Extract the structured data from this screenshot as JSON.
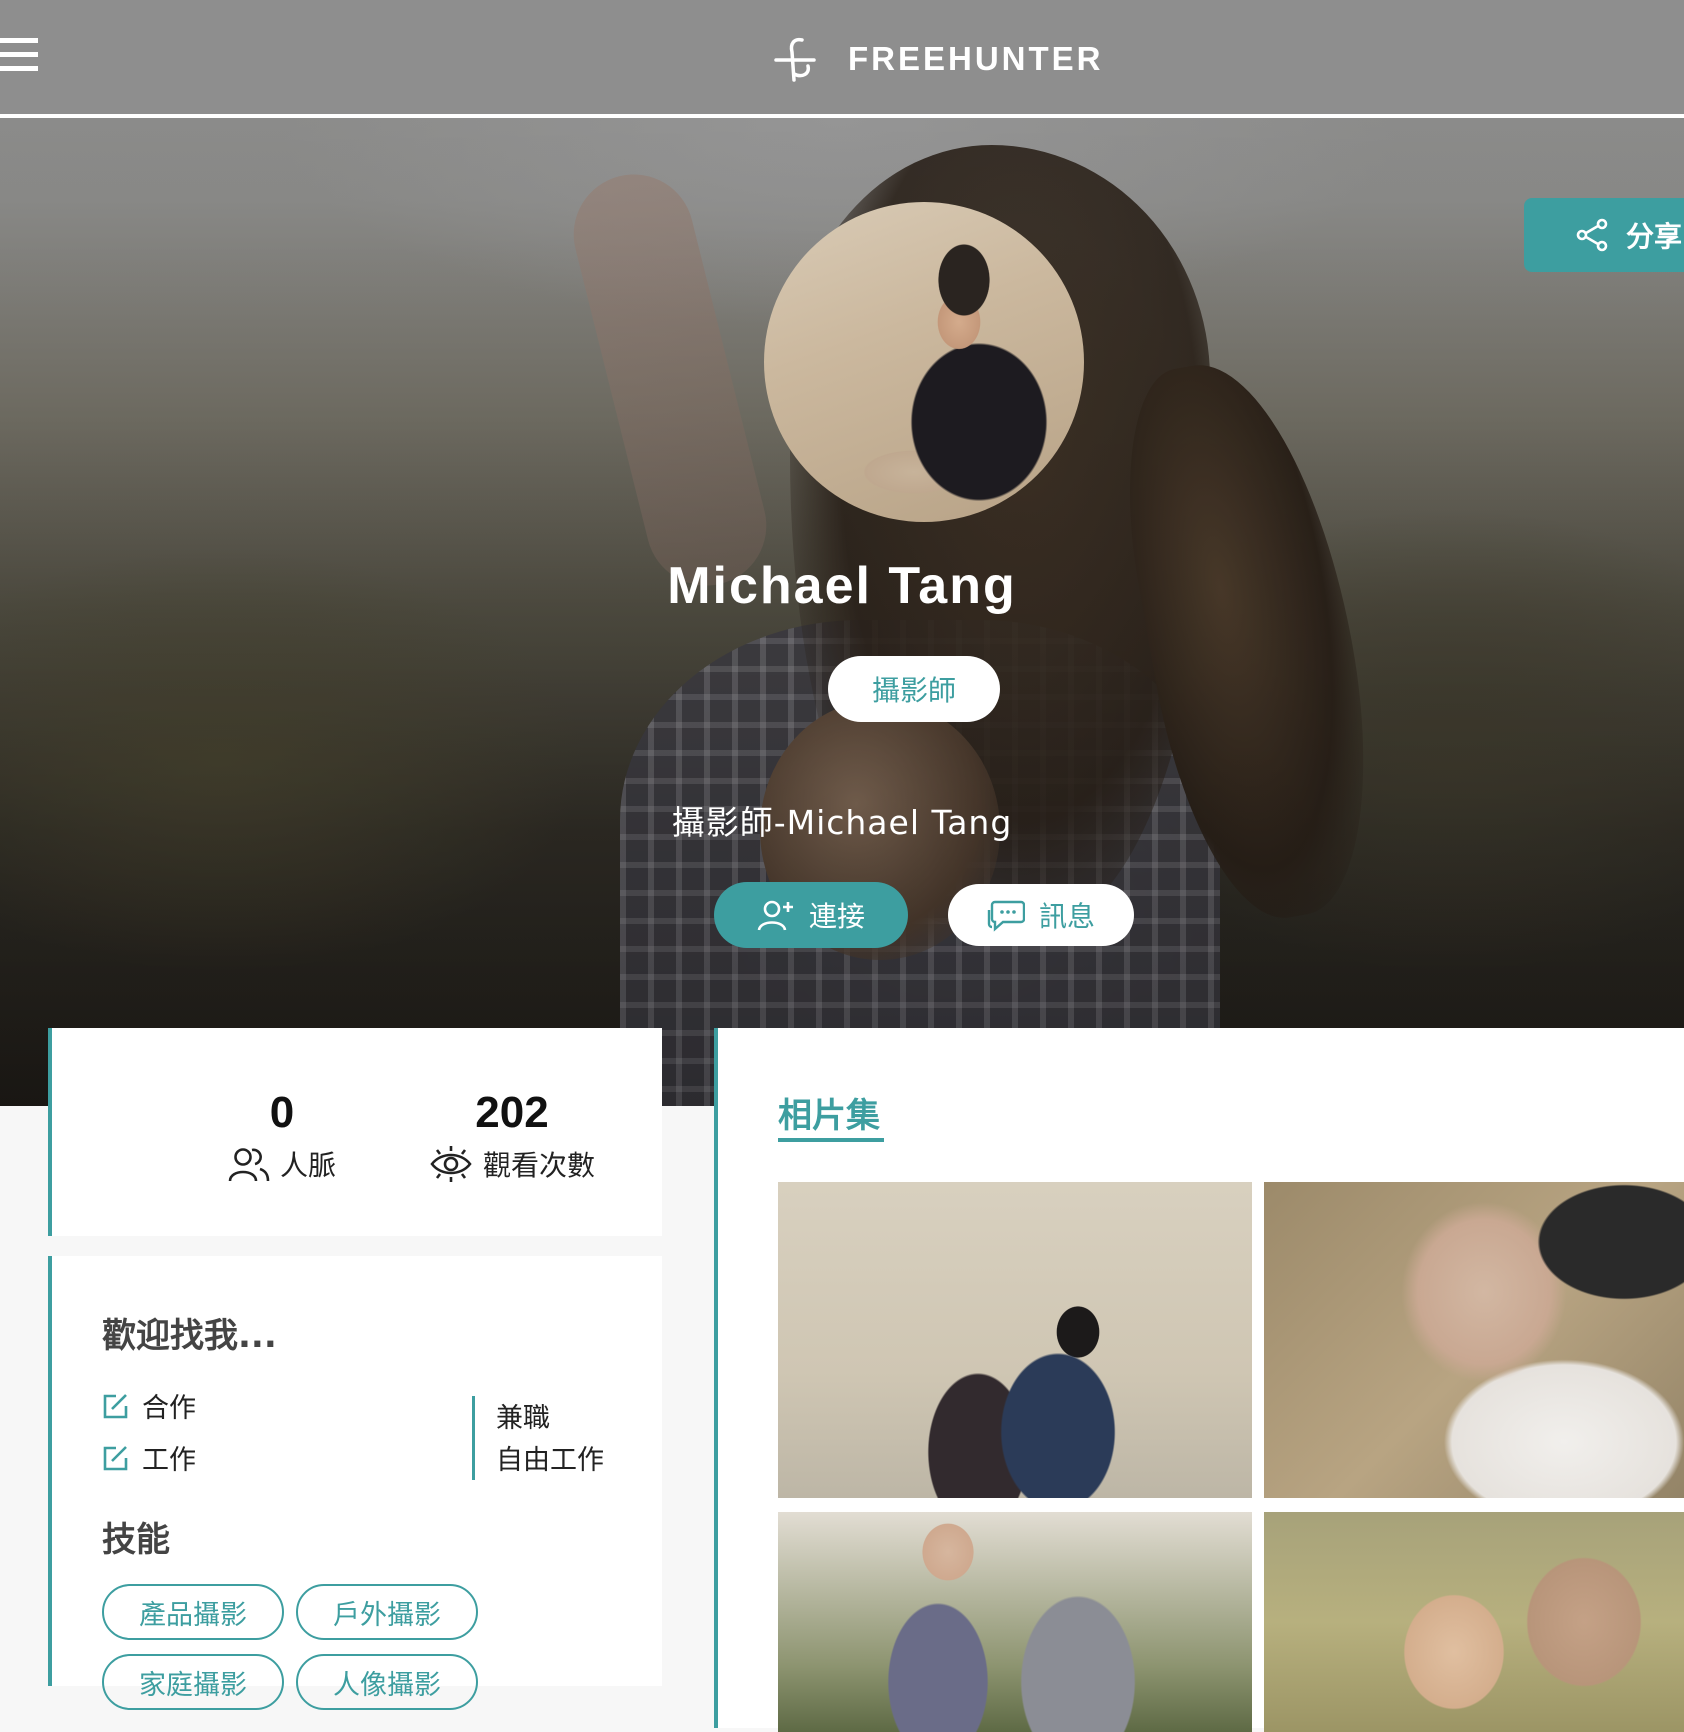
{
  "brand": {
    "name": "FREEHUNTER"
  },
  "share": {
    "label": "分享"
  },
  "profile": {
    "name": "Michael Tang",
    "role": "攝影師",
    "headline": "攝影師-Michael Tang",
    "connect_label": "連接",
    "message_label": "訊息"
  },
  "stats": [
    {
      "value": "0",
      "label": "人脈",
      "icon": "people-icon"
    },
    {
      "value": "202",
      "label": "觀看次數",
      "icon": "eye-icon"
    }
  ],
  "welcome": {
    "title": "歡迎找我...",
    "options": [
      "合作",
      "工作"
    ],
    "work_types": [
      "兼職",
      "自由工作"
    ]
  },
  "skills": {
    "title": "技能",
    "items": [
      "產品攝影",
      "戶外攝影",
      "家庭攝影",
      "人像攝影"
    ]
  },
  "gallery": {
    "title": "相片集",
    "photos": [
      "couple-embrace-photo",
      "bride-groom-photo",
      "couple-plaid-photo",
      "couple-closeup-photo"
    ]
  },
  "colors": {
    "accent": "#3d9ea0",
    "topbar": "#8e8e8e"
  }
}
